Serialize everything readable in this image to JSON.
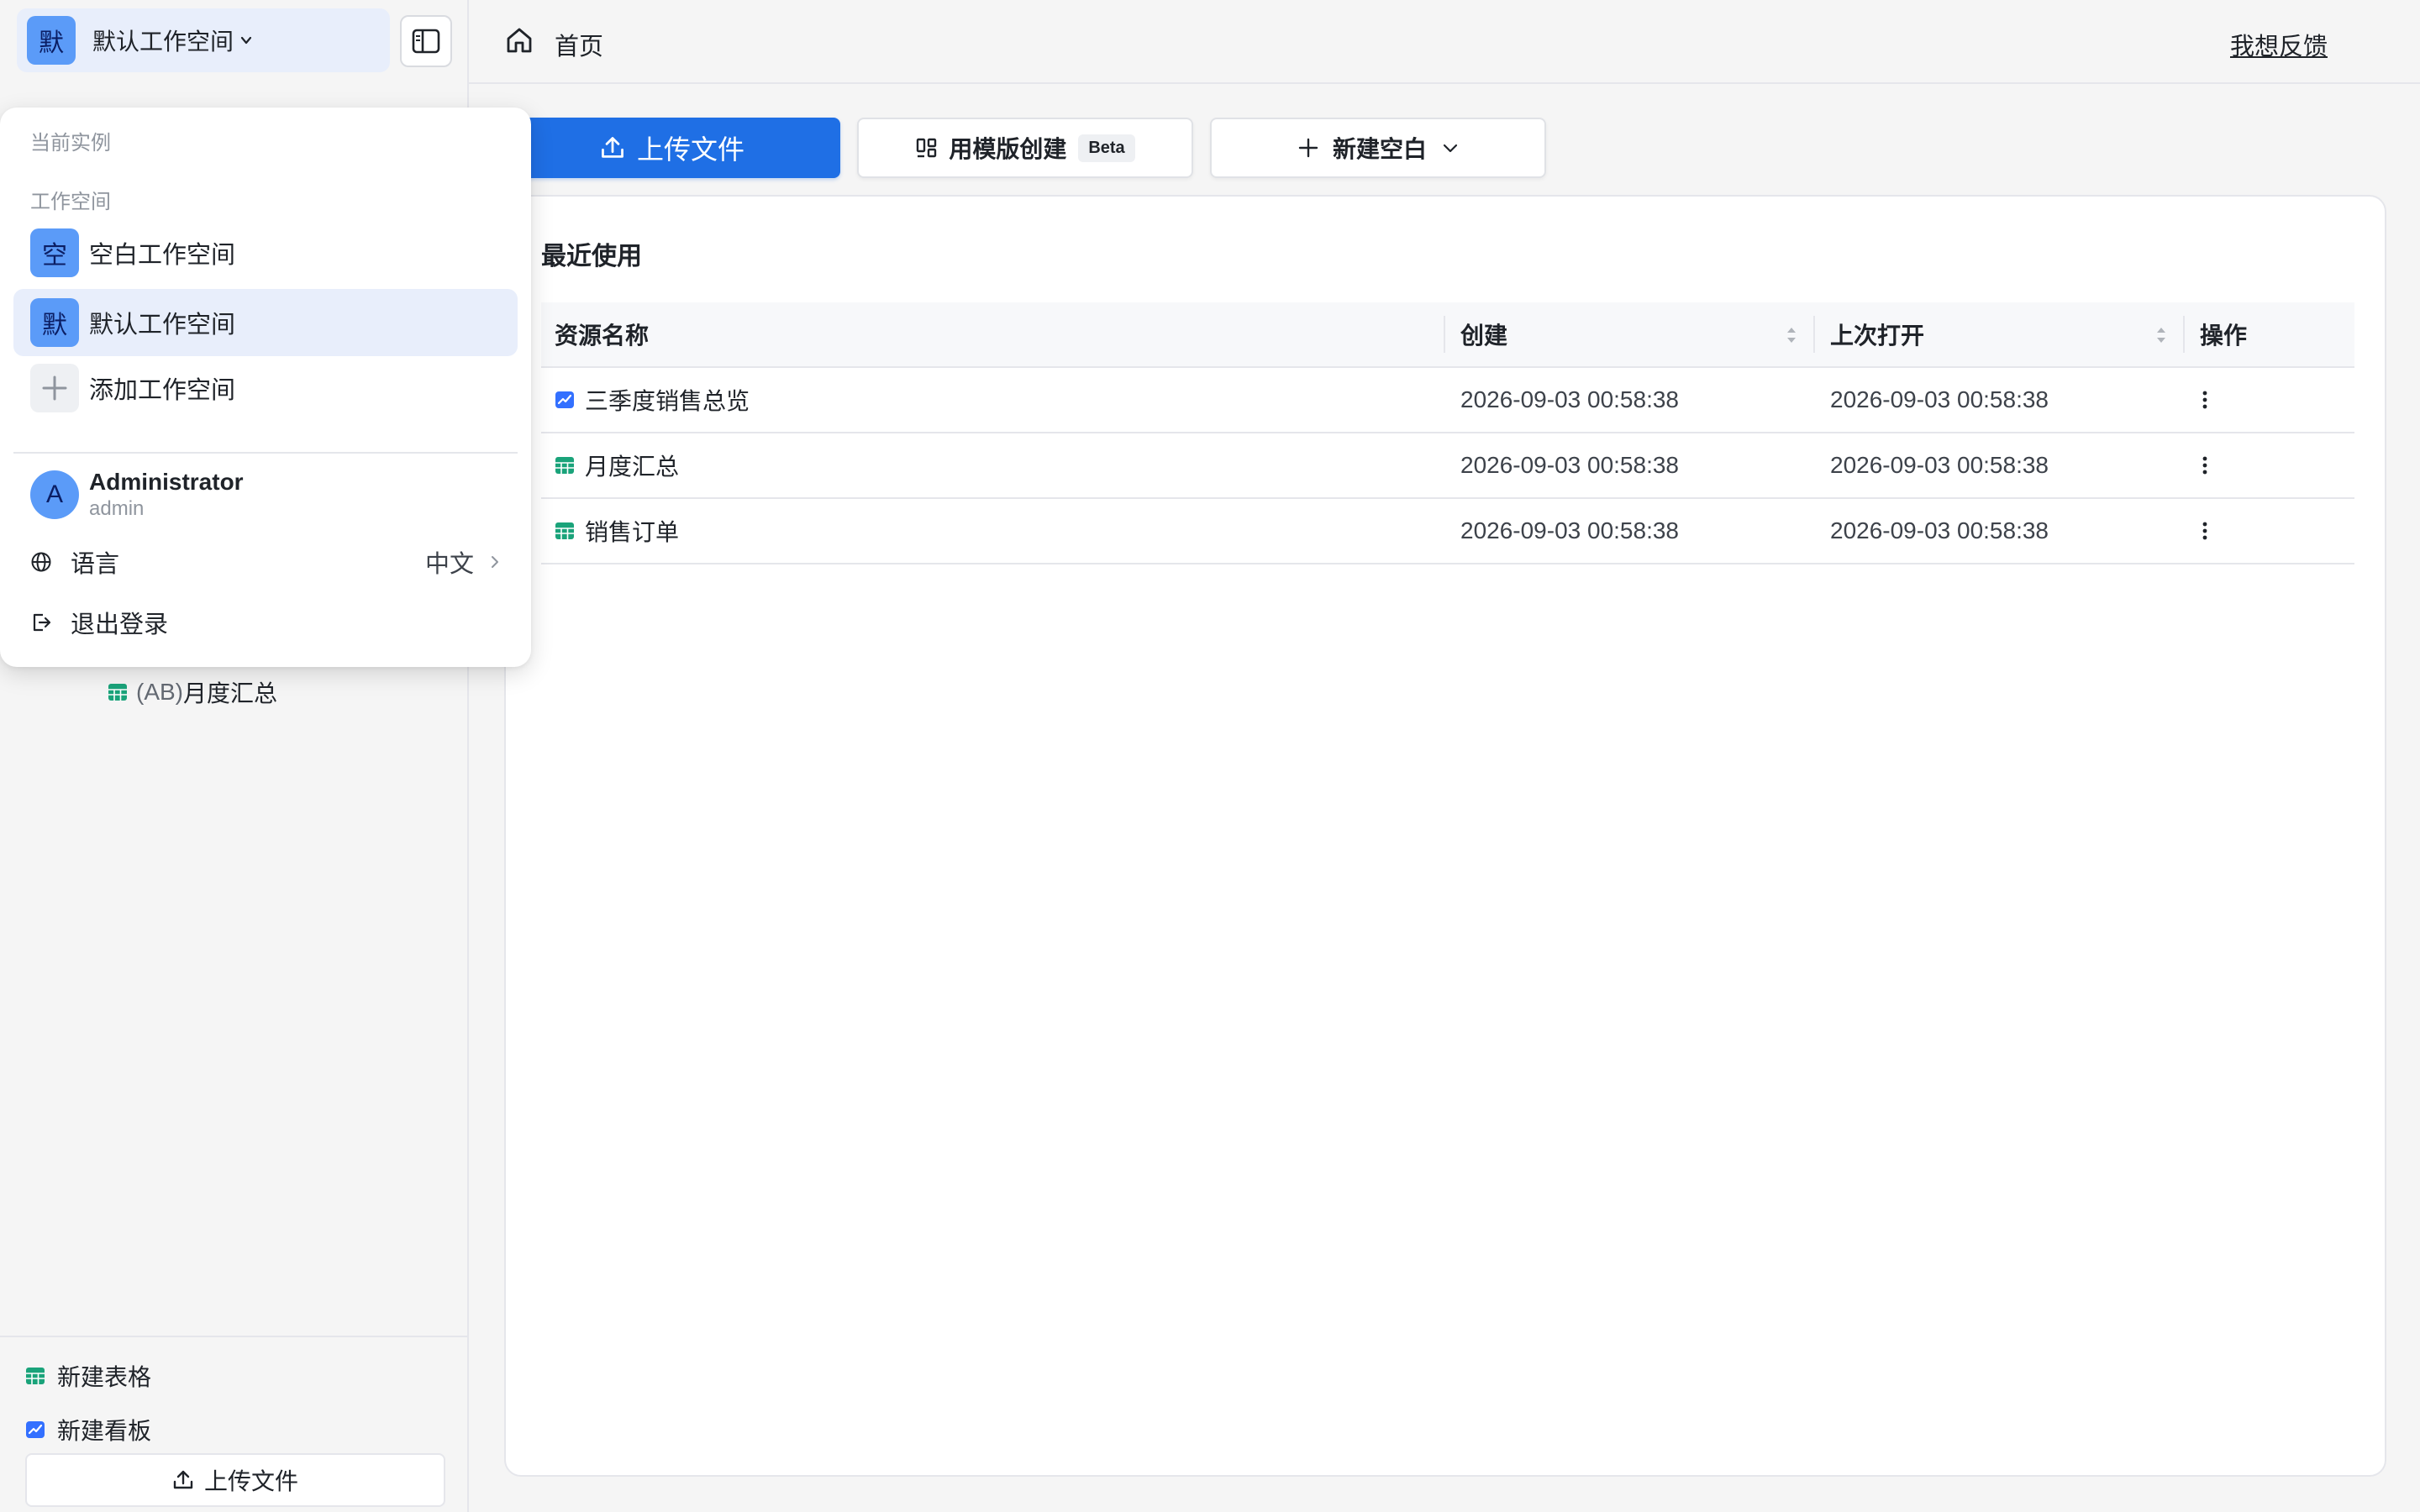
{
  "sidebar": {
    "workspace_avatar": "默",
    "workspace_name": "默认工作空间",
    "tree_item": {
      "prefix": "(AB)",
      "name": "月度汇总"
    },
    "bottom": {
      "new_sheet": "新建表格",
      "new_board": "新建看板",
      "upload": "上传文件"
    }
  },
  "header": {
    "home": "首页",
    "feedback": "我想反馈"
  },
  "actions": {
    "upload": "上传文件",
    "template": "用模版创建",
    "template_badge": "Beta",
    "new_blank": "新建空白"
  },
  "recent": {
    "title": "最近使用",
    "columns": [
      "资源名称",
      "创建",
      "上次打开",
      "操作"
    ],
    "rows": [
      {
        "type": "dashboard",
        "name": "三季度销售总览",
        "created": "2026-09-03 00:58:38",
        "opened": "2026-09-03 00:58:38"
      },
      {
        "type": "sheet",
        "name": "月度汇总",
        "created": "2026-09-03 00:58:38",
        "opened": "2026-09-03 00:58:38"
      },
      {
        "type": "sheet",
        "name": "销售订单",
        "created": "2026-09-03 00:58:38",
        "opened": "2026-09-03 00:58:38"
      }
    ]
  },
  "dropdown": {
    "current_instance_label": "当前实例",
    "workspace_label": "工作空间",
    "workspaces": [
      {
        "avatar": "空",
        "name": "空白工作空间",
        "active": false
      },
      {
        "avatar": "默",
        "name": "默认工作空间",
        "active": true
      }
    ],
    "add_workspace": "添加工作空间",
    "user": {
      "avatar": "A",
      "name": "Administrator",
      "username": "admin"
    },
    "language_label": "语言",
    "language_value": "中文",
    "logout": "退出登录"
  },
  "colors": {
    "primary": "#1f6fe5",
    "avatar": "#5b9bf8",
    "active_bg": "#e8eefb",
    "sheet_icon": "#1aa37a",
    "dashboard_icon": "#3370ff"
  }
}
